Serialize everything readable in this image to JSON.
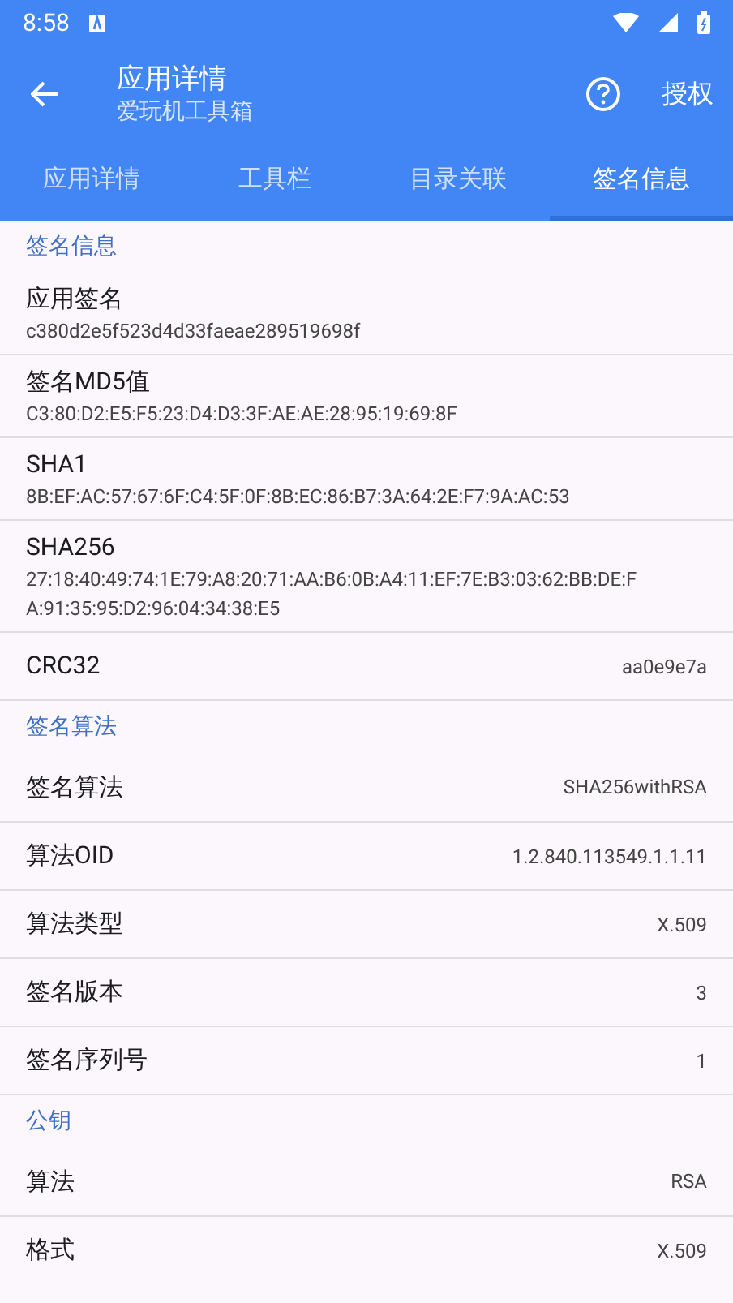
{
  "status_bar": {
    "time": "8:58"
  },
  "toolbar": {
    "title": "应用详情",
    "subtitle": "爱玩机工具箱",
    "action": "授权"
  },
  "tabs": [
    {
      "label": "应用详情",
      "selected": false
    },
    {
      "label": "工具栏",
      "selected": false
    },
    {
      "label": "目录关联",
      "selected": false
    },
    {
      "label": "签名信息",
      "selected": true
    }
  ],
  "sections": [
    {
      "title": "签名信息",
      "rows": [
        {
          "kind": "stacked",
          "label": "应用签名",
          "value": "c380d2e5f523d4d33faeae289519698f"
        },
        {
          "kind": "stacked",
          "label": "签名MD5值",
          "value": "C3:80:D2:E5:F5:23:D4:D3:3F:AE:AE:28:95:19:69:8F"
        },
        {
          "kind": "stacked",
          "label": "SHA1",
          "value": "8B:EF:AC:57:67:6F:C4:5F:0F:8B:EC:86:B7:3A:64:2E:F7:9A:AC:53"
        },
        {
          "kind": "stacked",
          "label": "SHA256",
          "value": "27:18:40:49:74:1E:79:A8:20:71:AA:B6:0B:A4:11:EF:7E:B3:03:62:BB:DE:FA:91:35:95:D2:96:04:34:38:E5"
        },
        {
          "kind": "inline",
          "label": "CRC32",
          "value": "aa0e9e7a"
        }
      ]
    },
    {
      "title": "签名算法",
      "rows": [
        {
          "kind": "inline",
          "label": "签名算法",
          "value": "SHA256withRSA"
        },
        {
          "kind": "inline",
          "label": "算法OID",
          "value": "1.2.840.113549.1.1.11"
        },
        {
          "kind": "inline",
          "label": "算法类型",
          "value": "X.509"
        },
        {
          "kind": "inline",
          "label": "签名版本",
          "value": "3"
        },
        {
          "kind": "inline",
          "label": "签名序列号",
          "value": "1"
        }
      ]
    },
    {
      "title": "公钥",
      "rows": [
        {
          "kind": "inline",
          "label": "算法",
          "value": "RSA"
        },
        {
          "kind": "inline",
          "label": "格式",
          "value": "X.509"
        }
      ]
    }
  ]
}
